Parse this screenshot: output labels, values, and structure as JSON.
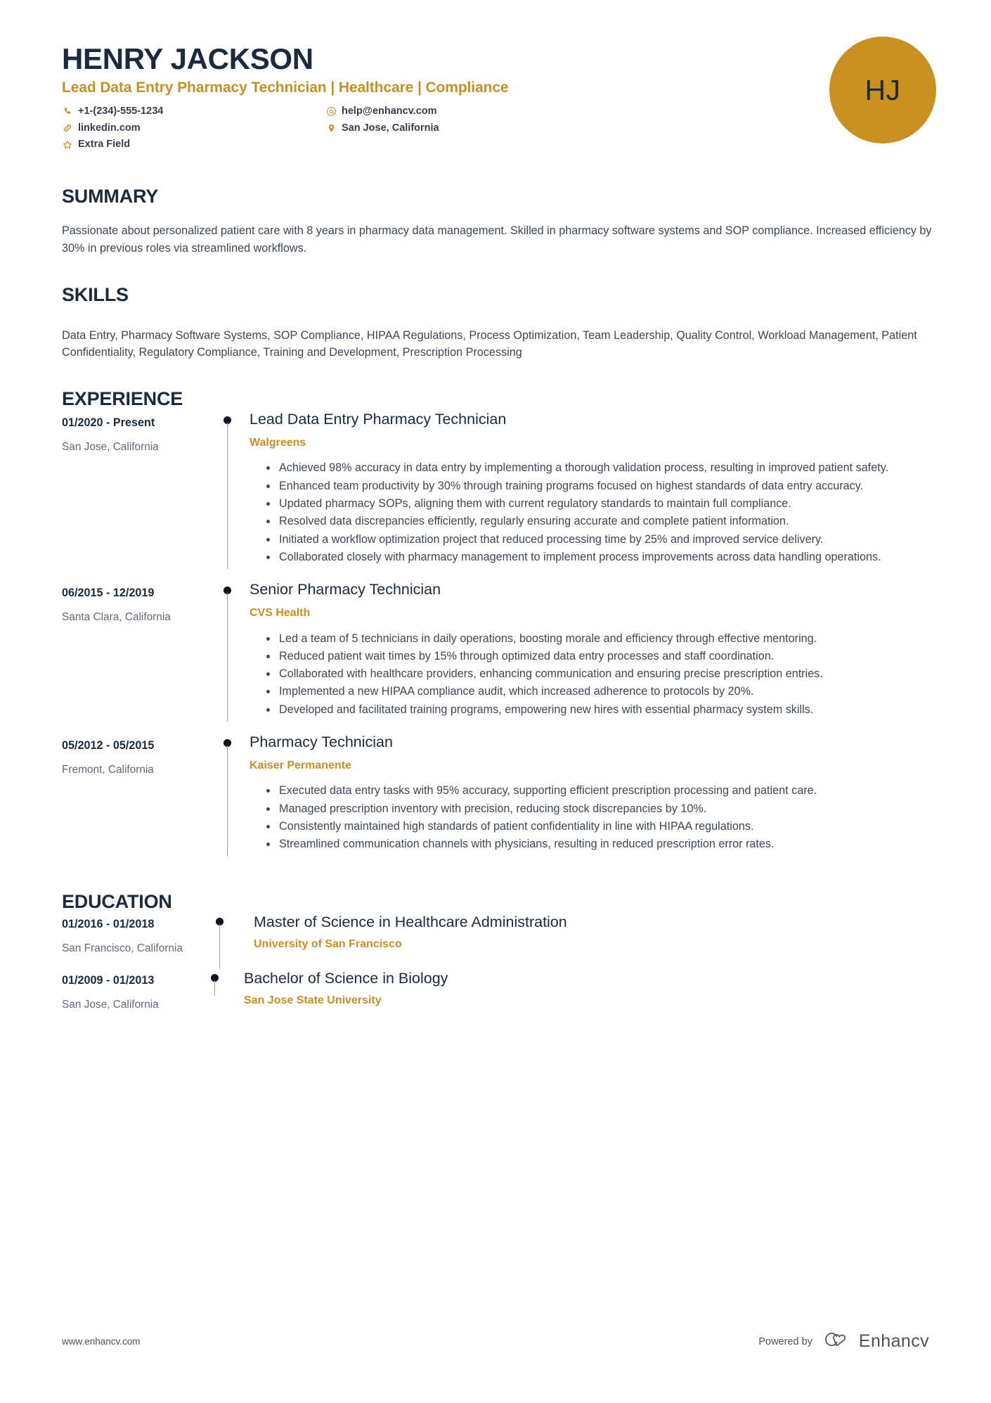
{
  "header": {
    "name": "HENRY JACKSON",
    "headline": "Lead Data Entry Pharmacy Technician | Healthcare | Compliance",
    "initials": "HJ",
    "accent_color": "#c9901f",
    "dark_color": "#1c2a3d",
    "contacts_left": [
      {
        "icon": "phone-icon",
        "text": "+1-(234)-555-1234"
      },
      {
        "icon": "link-icon",
        "text": "linkedin.com"
      },
      {
        "icon": "star-icon",
        "text": "Extra Field"
      }
    ],
    "contacts_right": [
      {
        "icon": "email-icon",
        "text": "help@enhancv.com"
      },
      {
        "icon": "location-pin-icon",
        "text": "San Jose, California"
      }
    ]
  },
  "summary": {
    "title": "SUMMARY",
    "text": "Passionate about personalized patient care with 8 years in pharmacy data management. Skilled in pharmacy software systems and SOP compliance. Increased efficiency by 30% in previous roles via streamlined workflows."
  },
  "skills": {
    "title": "SKILLS",
    "text": "Data Entry, Pharmacy Software Systems, SOP Compliance, HIPAA Regulations, Process Optimization, Team Leadership, Quality Control, Workload Management, Patient Confidentiality, Regulatory Compliance, Training and Development, Prescription Processing"
  },
  "experience": {
    "title": "EXPERIENCE",
    "entries": [
      {
        "date": "01/2020 - Present",
        "location": "San Jose, California",
        "title": "Lead Data Entry Pharmacy Technician",
        "company": "Walgreens",
        "bullets": [
          "Achieved 98% accuracy in data entry by implementing a thorough validation process, resulting in improved patient safety.",
          "Enhanced team productivity by 30% through training programs focused on highest standards of data entry accuracy.",
          "Updated pharmacy SOPs, aligning them with current regulatory standards to maintain full compliance.",
          "Resolved data discrepancies efficiently, regularly ensuring accurate and complete patient information.",
          "Initiated a workflow optimization project that reduced processing time by 25% and improved service delivery.",
          "Collaborated closely with pharmacy management to implement process improvements across data handling operations."
        ]
      },
      {
        "date": "06/2015 - 12/2019",
        "location": "Santa Clara, California",
        "title": "Senior Pharmacy Technician",
        "company": "CVS Health",
        "bullets": [
          "Led a team of 5 technicians in daily operations, boosting morale and efficiency through effective mentoring.",
          "Reduced patient wait times by 15% through optimized data entry processes and staff coordination.",
          "Collaborated with healthcare providers, enhancing communication and ensuring precise prescription entries.",
          "Implemented a new HIPAA compliance audit, which increased adherence to protocols by 20%.",
          "Developed and facilitated training programs, empowering new hires with essential pharmacy system skills."
        ]
      },
      {
        "date": "05/2012 - 05/2015",
        "location": "Fremont, California",
        "title": "Pharmacy Technician",
        "company": "Kaiser Permanente",
        "bullets": [
          "Executed data entry tasks with 95% accuracy, supporting efficient prescription processing and patient care.",
          "Managed prescription inventory with precision, reducing stock discrepancies by 10%.",
          "Consistently maintained high standards of patient confidentiality in line with HIPAA regulations.",
          "Streamlined communication channels with physicians, resulting in reduced prescription error rates."
        ]
      }
    ]
  },
  "education": {
    "title": "EDUCATION",
    "entries": [
      {
        "date": "01/2016 - 01/2018",
        "location": "San Francisco, California",
        "degree": "Master of Science in Healthcare Administration",
        "school": "University of San Francisco"
      },
      {
        "date": "01/2009 - 01/2013",
        "location": "San Jose, California",
        "degree": "Bachelor of Science in Biology",
        "school": "San Jose State University"
      }
    ]
  },
  "footer": {
    "url": "www.enhancv.com",
    "powered_by": "Powered by",
    "brand": "Enhancv"
  }
}
